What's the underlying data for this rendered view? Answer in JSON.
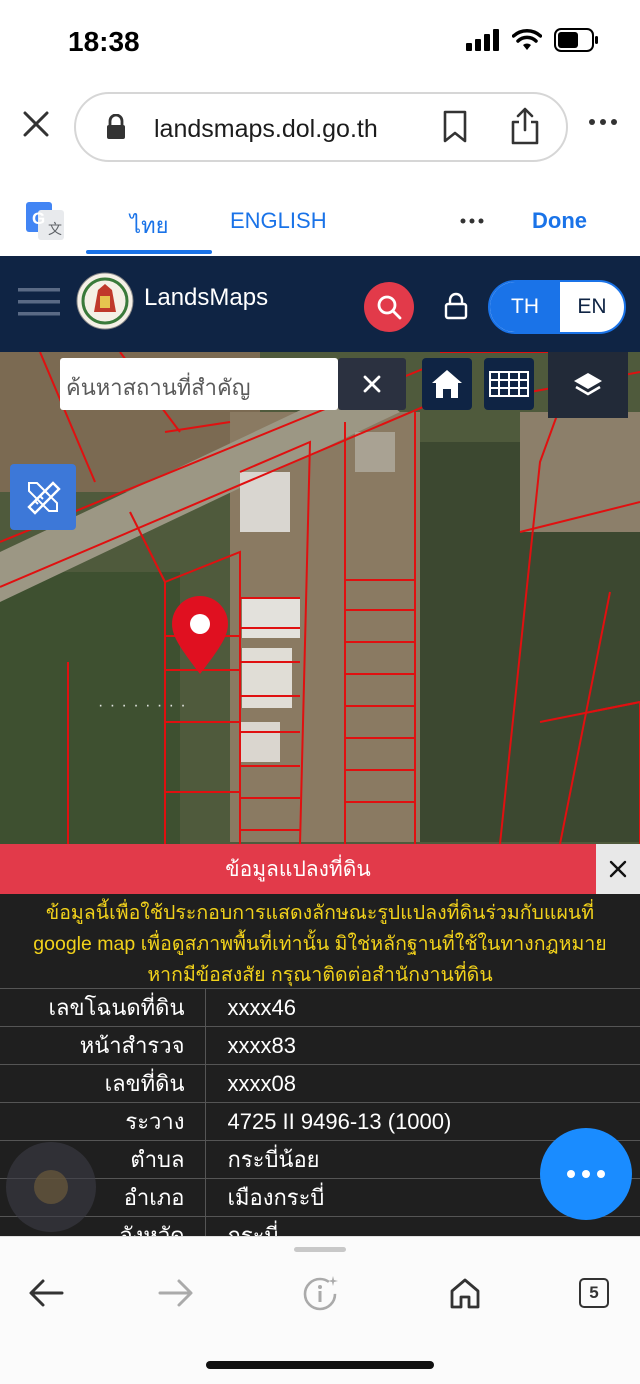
{
  "status_bar": {
    "time": "18:38"
  },
  "browser": {
    "url": "landsmaps.dol.go.th",
    "translate_tabs": [
      "ไทย",
      "ENGLISH"
    ],
    "translate_done": "Done"
  },
  "app": {
    "brand": "LandsMaps",
    "lang_th": "TH",
    "lang_en": "EN"
  },
  "map": {
    "search_placeholder": "ค้นหาสถานที่สำคัญ",
    "parcel_label": "·  ·  ·  ·  ·  ·  ·  ·"
  },
  "panel": {
    "title": "ข้อมูลแปลงที่ดิน",
    "notice_lines": [
      "ข้อมูลนี้เพื่อใช้ประกอบการแสดงลักษณะรูปแปลงที่ดินร่วมกับแผนที่",
      "google map เพื่อดูสภาพพื้นที่เท่านั้น มิใช่หลักฐานที่ใช้ในทางกฎหมาย",
      "หากมีข้อสงสัย กรุณาติดต่อสำนักงานที่ดิน"
    ],
    "rows": [
      {
        "label": "เลขโฉนดที่ดิน",
        "value": "xxxx46"
      },
      {
        "label": "หน้าสำรวจ",
        "value": "xxxx83"
      },
      {
        "label": "เลขที่ดิน",
        "value": "xxxx08"
      },
      {
        "label": "ระวาง",
        "value": "4725 II 9496-13 (1000)"
      },
      {
        "label": "ตำบล",
        "value": "กระบี่น้อย"
      },
      {
        "label": "อำเภอ",
        "value": "เมืองกระบี่"
      },
      {
        "label": "จังหวัด",
        "value": "กระบี่"
      }
    ]
  },
  "bottom_nav": {
    "tab_count": "5"
  },
  "colors": {
    "header": "#0f2444",
    "accent": "#1a73e8",
    "panel_title": "#e23a4a",
    "notice": "#f2d21b",
    "fab": "#1a8cff"
  }
}
